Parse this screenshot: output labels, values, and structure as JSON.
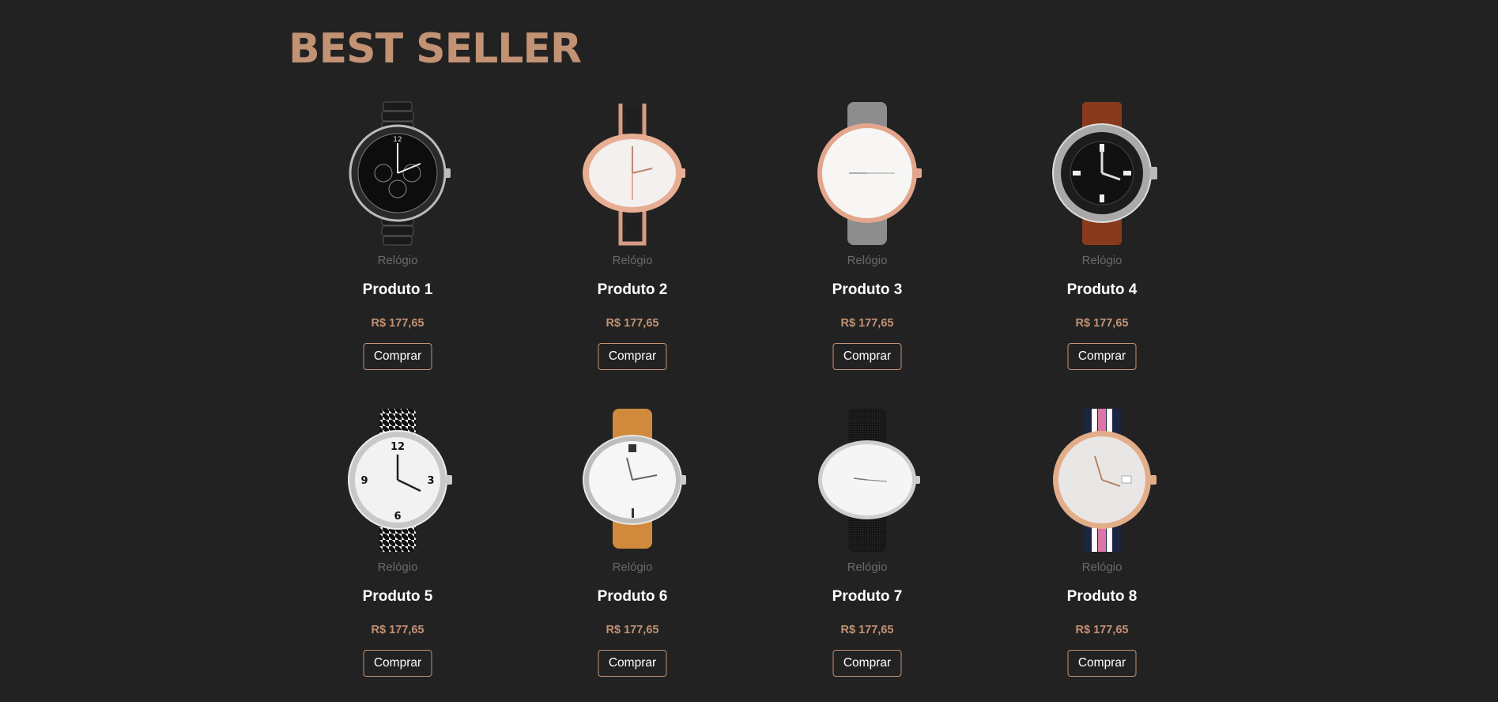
{
  "section": {
    "title": "BEST SELLER"
  },
  "colors": {
    "background": "#232222",
    "accent": "#c29274",
    "category_text": "#6b6968",
    "name_text": "#ffffff"
  },
  "products": [
    {
      "category": "Relógio",
      "name": "Produto 1",
      "price": "R$ 177,65",
      "button": "Comprar",
      "image": "black-ceramic-chronograph-watch"
    },
    {
      "category": "Relógio",
      "name": "Produto 2",
      "price": "R$ 177,65",
      "button": "Comprar",
      "image": "rose-gold-bracelet-watch"
    },
    {
      "category": "Relógio",
      "name": "Produto 3",
      "price": "R$ 177,65",
      "button": "Comprar",
      "image": "gray-leather-rose-gold-watch"
    },
    {
      "category": "Relógio",
      "name": "Produto 4",
      "price": "R$ 177,65",
      "button": "Comprar",
      "image": "brown-leather-diver-watch"
    },
    {
      "category": "Relógio",
      "name": "Produto 5",
      "price": "R$ 177,65",
      "button": "Comprar",
      "image": "houndstooth-strap-silver-watch"
    },
    {
      "category": "Relógio",
      "name": "Produto 6",
      "price": "R$ 177,65",
      "button": "Comprar",
      "image": "tan-leather-silver-watch"
    },
    {
      "category": "Relógio",
      "name": "Produto 7",
      "price": "R$ 177,65",
      "button": "Comprar",
      "image": "black-mesh-silver-watch"
    },
    {
      "category": "Relógio",
      "name": "Produto 8",
      "price": "R$ 177,65",
      "button": "Comprar",
      "image": "striped-nato-gold-watch"
    }
  ]
}
